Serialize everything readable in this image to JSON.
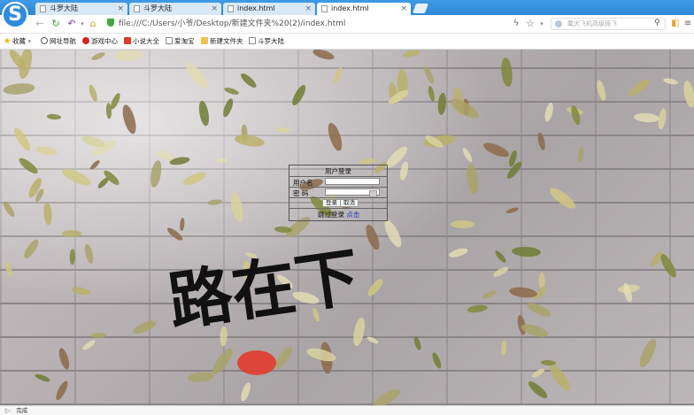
{
  "browser": {
    "tabs": [
      {
        "title": "斗罗大陆",
        "active": false
      },
      {
        "title": "斗罗大陆",
        "active": false
      },
      {
        "title": "index.html",
        "active": false
      },
      {
        "title": "index.html",
        "active": true
      }
    ],
    "address": "file:///C:/Users/小爷/Desktop/新建文件夹%20(2)/index.html",
    "search_placeholder": "載犬飞机高级摔飞",
    "icons": {
      "back": "back-arrow-icon",
      "refresh": "refresh-icon",
      "undo": "undo-icon",
      "home": "home-icon",
      "bolt": "lightning-icon",
      "star": "star-icon",
      "search": "magnifier-icon"
    }
  },
  "bookmarks": [
    {
      "label": "收藏",
      "icon": "star-icon",
      "color": "#f5b400"
    },
    {
      "label": "网址导航",
      "icon": "globe-icon",
      "color": "#5a5a5a"
    },
    {
      "label": "游戏中心",
      "icon": "game-icon",
      "color": "#e02020"
    },
    {
      "label": "小说大全",
      "icon": "book-icon",
      "color": "#e03a2a"
    },
    {
      "label": "爱淘宝",
      "icon": "page-icon",
      "color": "#888888"
    },
    {
      "label": "新建文件夹",
      "icon": "folder-icon",
      "color": "#f2c14e"
    },
    {
      "label": "斗罗大陆",
      "icon": "page-icon",
      "color": "#888888"
    }
  ],
  "login": {
    "title": "用户登录",
    "username_label": "用户名",
    "password_label": "密  码",
    "login_button": "登录",
    "cancel_button": "取消",
    "skip_text": "跳过登录",
    "skip_link": "点击"
  },
  "background": {
    "calligraphy": "路在下"
  },
  "status": {
    "text": "完成"
  }
}
